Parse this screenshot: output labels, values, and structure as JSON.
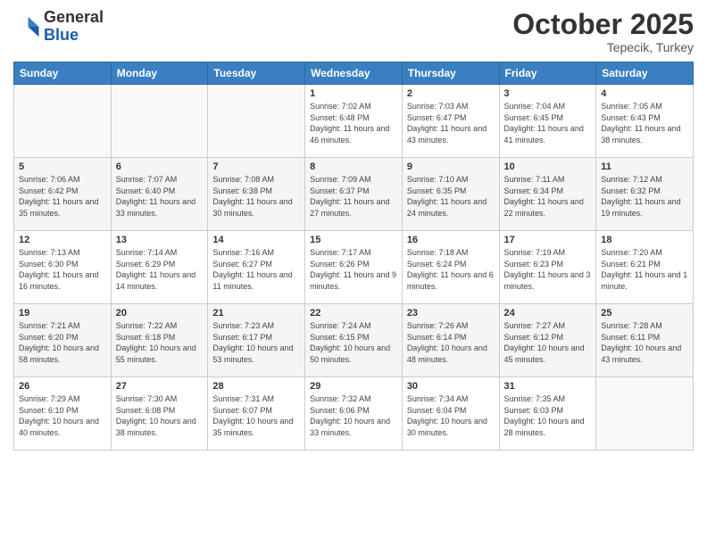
{
  "header": {
    "logo_general": "General",
    "logo_blue": "Blue",
    "month": "October 2025",
    "location": "Tepecik, Turkey"
  },
  "days_of_week": [
    "Sunday",
    "Monday",
    "Tuesday",
    "Wednesday",
    "Thursday",
    "Friday",
    "Saturday"
  ],
  "weeks": [
    [
      {
        "day": "",
        "info": ""
      },
      {
        "day": "",
        "info": ""
      },
      {
        "day": "",
        "info": ""
      },
      {
        "day": "1",
        "info": "Sunrise: 7:02 AM\nSunset: 6:48 PM\nDaylight: 11 hours and 46 minutes."
      },
      {
        "day": "2",
        "info": "Sunrise: 7:03 AM\nSunset: 6:47 PM\nDaylight: 11 hours and 43 minutes."
      },
      {
        "day": "3",
        "info": "Sunrise: 7:04 AM\nSunset: 6:45 PM\nDaylight: 11 hours and 41 minutes."
      },
      {
        "day": "4",
        "info": "Sunrise: 7:05 AM\nSunset: 6:43 PM\nDaylight: 11 hours and 38 minutes."
      }
    ],
    [
      {
        "day": "5",
        "info": "Sunrise: 7:06 AM\nSunset: 6:42 PM\nDaylight: 11 hours and 35 minutes."
      },
      {
        "day": "6",
        "info": "Sunrise: 7:07 AM\nSunset: 6:40 PM\nDaylight: 11 hours and 33 minutes."
      },
      {
        "day": "7",
        "info": "Sunrise: 7:08 AM\nSunset: 6:38 PM\nDaylight: 11 hours and 30 minutes."
      },
      {
        "day": "8",
        "info": "Sunrise: 7:09 AM\nSunset: 6:37 PM\nDaylight: 11 hours and 27 minutes."
      },
      {
        "day": "9",
        "info": "Sunrise: 7:10 AM\nSunset: 6:35 PM\nDaylight: 11 hours and 24 minutes."
      },
      {
        "day": "10",
        "info": "Sunrise: 7:11 AM\nSunset: 6:34 PM\nDaylight: 11 hours and 22 minutes."
      },
      {
        "day": "11",
        "info": "Sunrise: 7:12 AM\nSunset: 6:32 PM\nDaylight: 11 hours and 19 minutes."
      }
    ],
    [
      {
        "day": "12",
        "info": "Sunrise: 7:13 AM\nSunset: 6:30 PM\nDaylight: 11 hours and 16 minutes."
      },
      {
        "day": "13",
        "info": "Sunrise: 7:14 AM\nSunset: 6:29 PM\nDaylight: 11 hours and 14 minutes."
      },
      {
        "day": "14",
        "info": "Sunrise: 7:16 AM\nSunset: 6:27 PM\nDaylight: 11 hours and 11 minutes."
      },
      {
        "day": "15",
        "info": "Sunrise: 7:17 AM\nSunset: 6:26 PM\nDaylight: 11 hours and 9 minutes."
      },
      {
        "day": "16",
        "info": "Sunrise: 7:18 AM\nSunset: 6:24 PM\nDaylight: 11 hours and 6 minutes."
      },
      {
        "day": "17",
        "info": "Sunrise: 7:19 AM\nSunset: 6:23 PM\nDaylight: 11 hours and 3 minutes."
      },
      {
        "day": "18",
        "info": "Sunrise: 7:20 AM\nSunset: 6:21 PM\nDaylight: 11 hours and 1 minute."
      }
    ],
    [
      {
        "day": "19",
        "info": "Sunrise: 7:21 AM\nSunset: 6:20 PM\nDaylight: 10 hours and 58 minutes."
      },
      {
        "day": "20",
        "info": "Sunrise: 7:22 AM\nSunset: 6:18 PM\nDaylight: 10 hours and 55 minutes."
      },
      {
        "day": "21",
        "info": "Sunrise: 7:23 AM\nSunset: 6:17 PM\nDaylight: 10 hours and 53 minutes."
      },
      {
        "day": "22",
        "info": "Sunrise: 7:24 AM\nSunset: 6:15 PM\nDaylight: 10 hours and 50 minutes."
      },
      {
        "day": "23",
        "info": "Sunrise: 7:26 AM\nSunset: 6:14 PM\nDaylight: 10 hours and 48 minutes."
      },
      {
        "day": "24",
        "info": "Sunrise: 7:27 AM\nSunset: 6:12 PM\nDaylight: 10 hours and 45 minutes."
      },
      {
        "day": "25",
        "info": "Sunrise: 7:28 AM\nSunset: 6:11 PM\nDaylight: 10 hours and 43 minutes."
      }
    ],
    [
      {
        "day": "26",
        "info": "Sunrise: 7:29 AM\nSunset: 6:10 PM\nDaylight: 10 hours and 40 minutes."
      },
      {
        "day": "27",
        "info": "Sunrise: 7:30 AM\nSunset: 6:08 PM\nDaylight: 10 hours and 38 minutes."
      },
      {
        "day": "28",
        "info": "Sunrise: 7:31 AM\nSunset: 6:07 PM\nDaylight: 10 hours and 35 minutes."
      },
      {
        "day": "29",
        "info": "Sunrise: 7:32 AM\nSunset: 6:06 PM\nDaylight: 10 hours and 33 minutes."
      },
      {
        "day": "30",
        "info": "Sunrise: 7:34 AM\nSunset: 6:04 PM\nDaylight: 10 hours and 30 minutes."
      },
      {
        "day": "31",
        "info": "Sunrise: 7:35 AM\nSunset: 6:03 PM\nDaylight: 10 hours and 28 minutes."
      },
      {
        "day": "",
        "info": ""
      }
    ]
  ]
}
